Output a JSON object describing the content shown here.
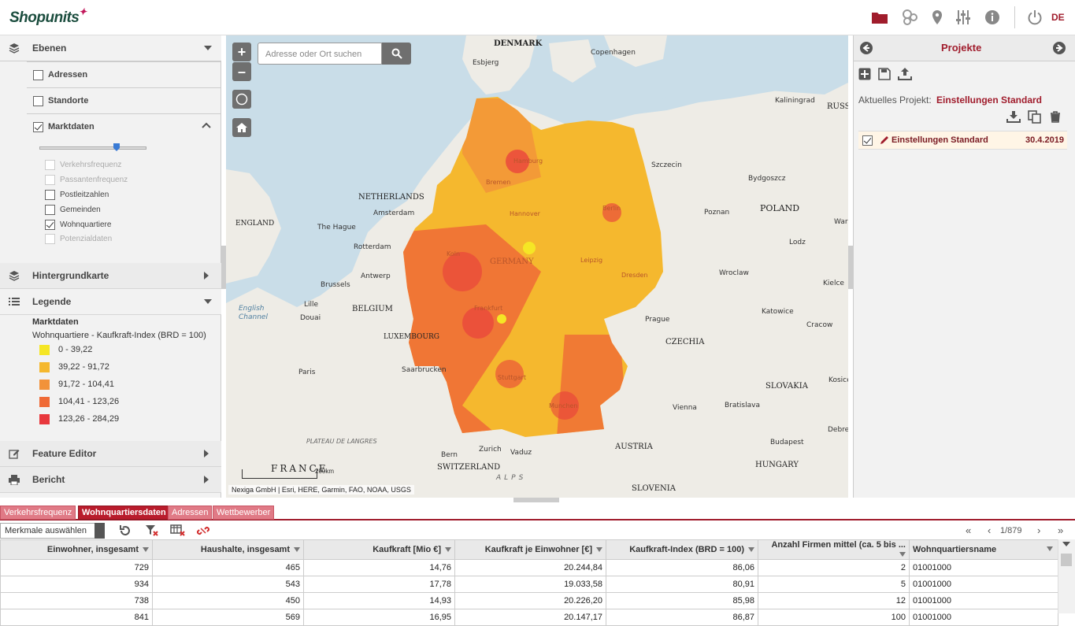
{
  "header": {
    "logo": "Shopunits",
    "lang": "DE",
    "icons": [
      "folder-icon",
      "network-icon",
      "location-pin-icon",
      "sliders-icon",
      "info-icon",
      "power-icon"
    ],
    "accent": "#a01c2c"
  },
  "left": {
    "ebenen": {
      "label": "Ebenen",
      "items": [
        {
          "label": "Adressen",
          "checked": false
        },
        {
          "label": "Standorte",
          "checked": false
        },
        {
          "label": "Marktdaten",
          "checked": true
        }
      ],
      "slider_value": 0.72,
      "sub": [
        {
          "label": "Verkehrsfrequenz",
          "checked": false,
          "disabled": true
        },
        {
          "label": "Passantenfrequenz",
          "checked": false,
          "disabled": true
        },
        {
          "label": "Postleitzahlen",
          "checked": false,
          "disabled": false
        },
        {
          "label": "Gemeinden",
          "checked": false,
          "disabled": false
        },
        {
          "label": "Wohnquartiere",
          "checked": true,
          "disabled": false
        },
        {
          "label": "Potenzialdaten",
          "checked": false,
          "disabled": true
        }
      ]
    },
    "hintergrund": {
      "label": "Hintergrundkarte"
    },
    "legende": {
      "label": "Legende",
      "title": "Marktdaten",
      "subtitle": "Wohnquartiere - Kaufkraft-Index (BRD = 100)",
      "classes": [
        {
          "label": "0 - 39,22",
          "color": "#f5e625"
        },
        {
          "label": "39,22 - 91,72",
          "color": "#f5b82e"
        },
        {
          "label": "91,72 - 104,41",
          "color": "#f2923a"
        },
        {
          "label": "104,41 - 123,26",
          "color": "#ef6a36"
        },
        {
          "label": "123,26 - 284,29",
          "color": "#e8383d"
        }
      ]
    },
    "feature_editor": {
      "label": "Feature Editor"
    },
    "bericht": {
      "label": "Bericht"
    }
  },
  "map": {
    "search_placeholder": "Adresse oder Ort suchen",
    "attribution": "Nexiga GmbH | Esri, HERE, Garmin, FAO, NOAA, USGS",
    "scale_label": "200km",
    "countries": [
      "DENMARK",
      "NETHERLANDS",
      "BELGIUM",
      "POLAND",
      "CZECHIA",
      "AUSTRIA",
      "SLOVAKIA",
      "HUNGARY",
      "SWITZERLAND",
      "FRANCE",
      "SLOVENIA",
      "ENGLAND",
      "GERMANY",
      "LUXEMBOURG",
      "RUSS"
    ],
    "cities": [
      "Esbjerg",
      "Copenhagen",
      "Kaliningrad",
      "Szczecin",
      "Bydgoszcz",
      "Poznan",
      "Amsterdam",
      "The Hague",
      "Rotterdam",
      "Antwerp",
      "Brussels",
      "Lille",
      "Douai",
      "Paris",
      "Saarbrucken",
      "Wroclaw",
      "Lodz",
      "Kielce",
      "Katowice",
      "Cracow",
      "Prague",
      "Vienna",
      "Bratislava",
      "Budapest",
      "Zurich",
      "Vaduz",
      "Bern",
      "Kosice",
      "Debre",
      "Warsa",
      "English Channel",
      "PLATEAU DE LANGRES",
      "ALPS",
      "Hamburg",
      "Bremen",
      "Berlin",
      "Dresden",
      "Koln",
      "Frankfurt",
      "Stuttgart",
      "Munchen",
      "Hannover",
      "Leipzig"
    ]
  },
  "right": {
    "title": "Projekte",
    "current_label": "Aktuelles Projekt:",
    "current_value": "Einstellungen Standard",
    "project": {
      "name": "Einstellungen Standard",
      "date": "30.4.2019",
      "checked": true
    }
  },
  "bottom": {
    "tabs": [
      {
        "label": "Verkehrsfrequenz",
        "active": false
      },
      {
        "label": "Wohnquartiersdaten",
        "active": true
      },
      {
        "label": "Adressen",
        "active": false
      },
      {
        "label": "Wettbewerber",
        "active": false
      }
    ],
    "select_label": "Merkmale auswählen",
    "page": "1/879",
    "columns": [
      "Einwohner, insgesamt",
      "Haushalte, insgesamt",
      "Kaufkraft [Mio €]",
      "Kaufkraft je Einwohner [€]",
      "Kaufkraft-Index (BRD = 100)",
      "Anzahl Firmen mittel (ca. 5 bis ...",
      "Wohnquartiersname"
    ],
    "rows": [
      [
        "729",
        "465",
        "14,76",
        "20.244,84",
        "86,06",
        "2",
        "01001000"
      ],
      [
        "934",
        "543",
        "17,78",
        "19.033,58",
        "80,91",
        "5",
        "01001000"
      ],
      [
        "738",
        "450",
        "14,93",
        "20.226,20",
        "85,98",
        "12",
        "01001000"
      ],
      [
        "841",
        "569",
        "16,95",
        "20.147,17",
        "86,87",
        "100",
        "01001000"
      ]
    ]
  }
}
